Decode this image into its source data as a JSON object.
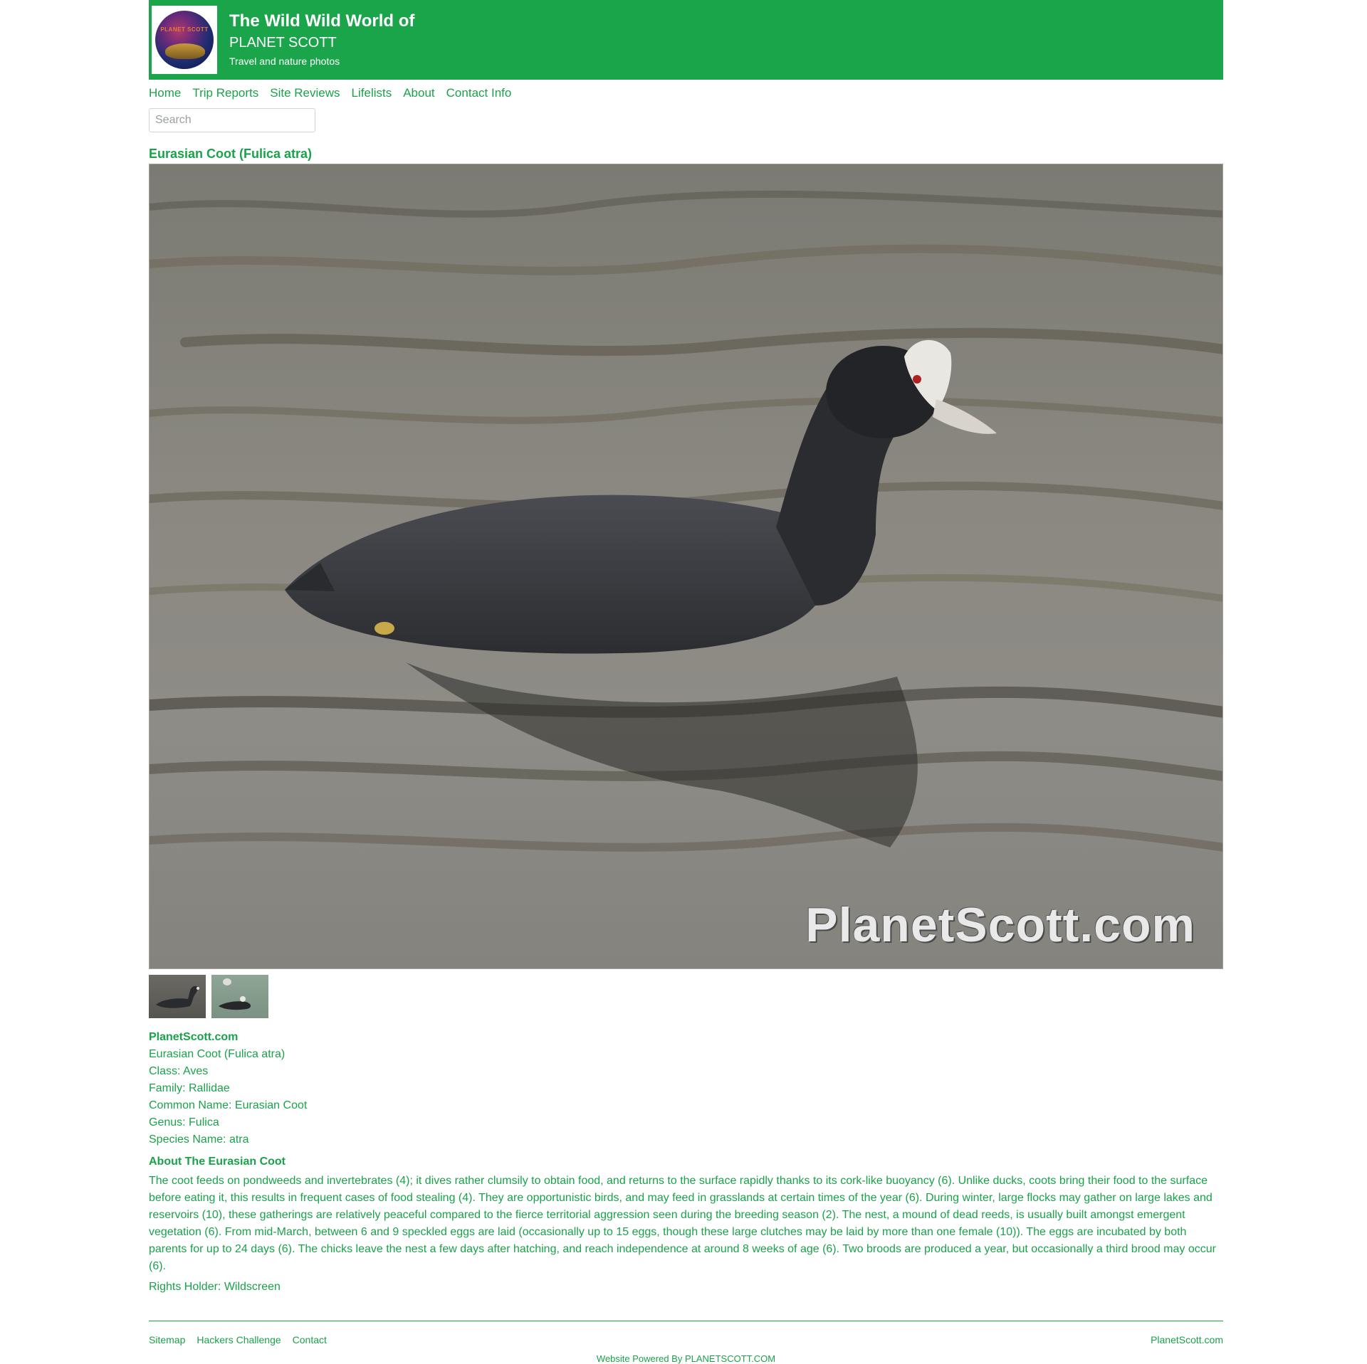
{
  "header": {
    "title": "The Wild Wild World of",
    "subtitle": "PLANET SCOTT",
    "tagline": "Travel and nature photos",
    "logo_text": "PLANET SCOTT"
  },
  "nav": [
    "Home",
    "Trip Reports",
    "Site Reviews",
    "Lifelists",
    "About",
    "Contact Info"
  ],
  "search": {
    "placeholder": "Search"
  },
  "photo": {
    "title": "Eurasian Coot (Fulica atra)",
    "watermark": "PlanetScott.com"
  },
  "info": {
    "site": "PlanetScott.com",
    "name": "Eurasian Coot (Fulica atra)",
    "class": "Class: Aves",
    "family": "Family: Rallidae",
    "common": "Common Name: Eurasian Coot",
    "genus": "Genus: Fulica",
    "species": "Species Name: atra"
  },
  "about": {
    "title": "About The Eurasian Coot",
    "text": "The coot feeds on pondweeds and invertebrates (4); it dives rather clumsily to obtain food, and returns to the surface rapidly thanks to its cork-like buoyancy (6). Unlike ducks, coots bring their food to the surface before eating it, this results in frequent cases of food stealing (4). They are opportunistic birds, and may feed in grasslands at certain times of the year (6). During winter, large flocks may gather on large lakes and reservoirs (10), these gatherings are relatively peaceful compared to the fierce territorial aggression seen during the breeding season (2). The nest, a mound of dead reeds, is usually built amongst emergent vegetation (6). From mid-March, between 6 and 9 speckled eggs are laid (occasionally up to 15 eggs, though these large clutches may be laid by more than one female (10)). The eggs are incubated by both parents for up to 24 days (6). The chicks leave the nest a few days after hatching, and reach independence at around 8 weeks of age (6). Two broods are produced a year, but occasionally a third brood may occur (6).",
    "rights": "Rights Holder: Wildscreen"
  },
  "footer": {
    "links": [
      "Sitemap",
      "Hackers Challenge",
      "Contact"
    ],
    "right": "PlanetScott.com",
    "powered": "Website Powered By PLANETSCOTT.COM"
  },
  "colors": {
    "brand_green": "#1aa54b",
    "text_green": "#1aa24a"
  }
}
